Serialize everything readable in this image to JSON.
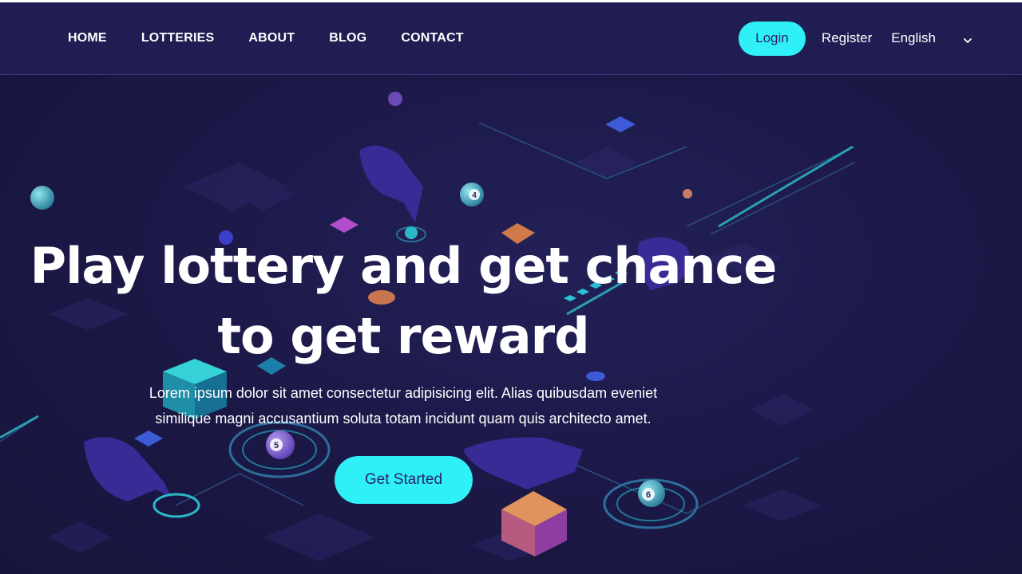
{
  "nav": {
    "items": [
      {
        "label": "HOME"
      },
      {
        "label": "LOTTERIES"
      },
      {
        "label": "ABOUT"
      },
      {
        "label": "BLOG"
      },
      {
        "label": "CONTACT"
      }
    ],
    "login_label": "Login",
    "register_label": "Register",
    "language": "English"
  },
  "hero": {
    "title_line1": "Play lottery and get chance",
    "title_line2": "to get reward",
    "description_line1": "Lorem ipsum dolor sit amet consectetur adipisicing elit. Alias quibusdam eveniet",
    "description_line2": "similique magni accusantium soluta totam incidunt quam quis architecto amet.",
    "cta_label": "Get Started"
  },
  "illustration": {
    "balls": [
      "4",
      "5",
      "6"
    ]
  },
  "colors": {
    "background": "#1b1846",
    "header": "#201d52",
    "accent": "#2ff0f7",
    "button_text": "#2a2563"
  },
  "icons": {
    "language_toggle": "chevron-down-icon"
  }
}
